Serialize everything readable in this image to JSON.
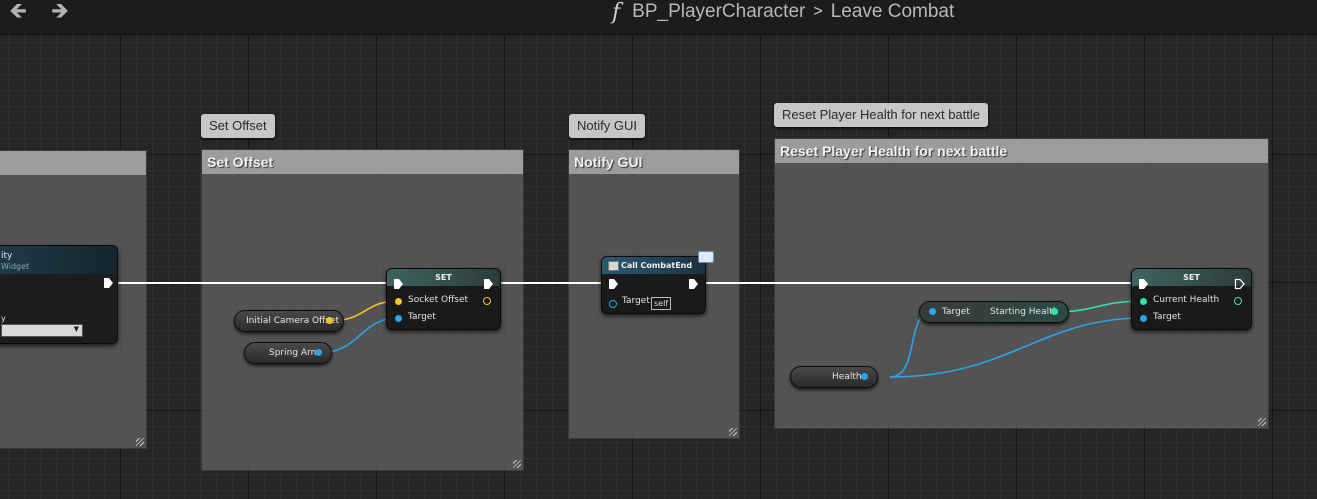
{
  "topbar": {
    "back_glyph": "🡸",
    "forward_glyph": "🡺",
    "function_glyph": "f",
    "blueprint": "BP_PlayerCharacter",
    "separator": ">",
    "graph": "Leave Combat"
  },
  "left_node": {
    "title_fragment": "ity",
    "subtitle_fragment": "Widget",
    "field_fragment": "y"
  },
  "comments": [
    {
      "bubble": "Set Offset",
      "header": "Set Offset"
    },
    {
      "bubble": "Notify GUI",
      "header": "Notify GUI"
    },
    {
      "bubble": "Reset Player Health for next battle",
      "header": "Reset Player Health for next battle"
    }
  ],
  "set_offset_node": {
    "title": "SET",
    "pin_socket": "Socket Offset",
    "pin_target": "Target"
  },
  "getters": {
    "initial_camera_offset": "Initial Camera Offset",
    "spring_arm": "Spring Arm",
    "health": "Health"
  },
  "call_node": {
    "title": "Call CombatEnd",
    "pin_target": "Target",
    "self_value": "self"
  },
  "starting_health_node": {
    "pin_target": "Target",
    "pin_output": "Starting Health"
  },
  "set_health_node": {
    "title": "SET",
    "pin_current": "Current Health",
    "pin_target": "Target"
  },
  "colors": {
    "exec_wire": "#ffffff",
    "vector_pin": "#f8c22f",
    "object_pin": "#2aa4ec",
    "float_pin": "#34e5a6",
    "set_header": "#3e6460",
    "call_header": "#2d5870"
  }
}
